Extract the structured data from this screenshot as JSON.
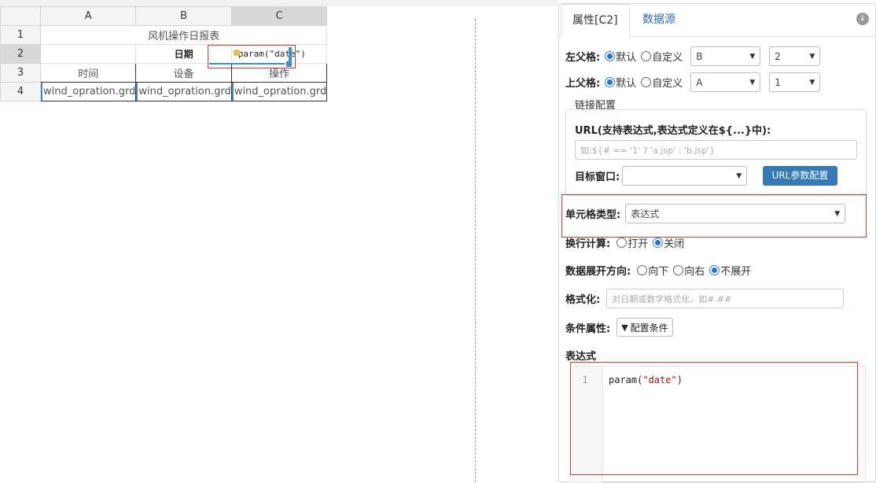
{
  "sheet": {
    "columns": [
      "A",
      "B",
      "C"
    ],
    "rows": [
      "1",
      "2",
      "3",
      "4"
    ],
    "title": "风机操作日报表",
    "date_label": "日期",
    "date_expr": "param(\"date\")",
    "headers": [
      "时间",
      "设备",
      "操作"
    ],
    "data_cells": [
      "wind_opration.grd",
      "wind_opration.grd",
      "wind_opration.grd"
    ]
  },
  "panel": {
    "tab_props": "属性[C2]",
    "tab_datasource": "数据源",
    "left_parent": {
      "label": "左父格:",
      "opt_default": "默认",
      "opt_custom": "自定义",
      "col": "B",
      "row": "2"
    },
    "top_parent": {
      "label": "上父格:",
      "opt_default": "默认",
      "opt_custom": "自定义",
      "col": "A",
      "row": "1"
    },
    "link": {
      "legend": "链接配置",
      "url_label": "URL(支持表达式,表达式定义在${...}中):",
      "url_placeholder": "如:${# == '1' ? 'a.jsp' : 'b.jsp'}",
      "target_label": "目标窗口:",
      "target_value": "",
      "param_button": "URL参数配置"
    },
    "cell_type": {
      "label": "单元格类型:",
      "value": "表达式"
    },
    "line_calc": {
      "label": "换行计算:",
      "opt_open": "打开",
      "opt_close": "关闭"
    },
    "expand": {
      "label": "数据展开方向:",
      "opt_down": "向下",
      "opt_right": "向右",
      "opt_none": "不展开"
    },
    "format": {
      "label": "格式化:",
      "placeholder": "对日期或数字格式化，如#.##"
    },
    "condition": {
      "label": "条件属性:",
      "button": "配置条件"
    },
    "expression": {
      "label": "表达式",
      "line_no": "1",
      "code_fn": "param(",
      "code_str": "\"date\"",
      "code_end": ")"
    }
  },
  "colors": {
    "accent": "#337ab7",
    "highlight": "#e0392b",
    "selection": "#3b8ed8"
  }
}
